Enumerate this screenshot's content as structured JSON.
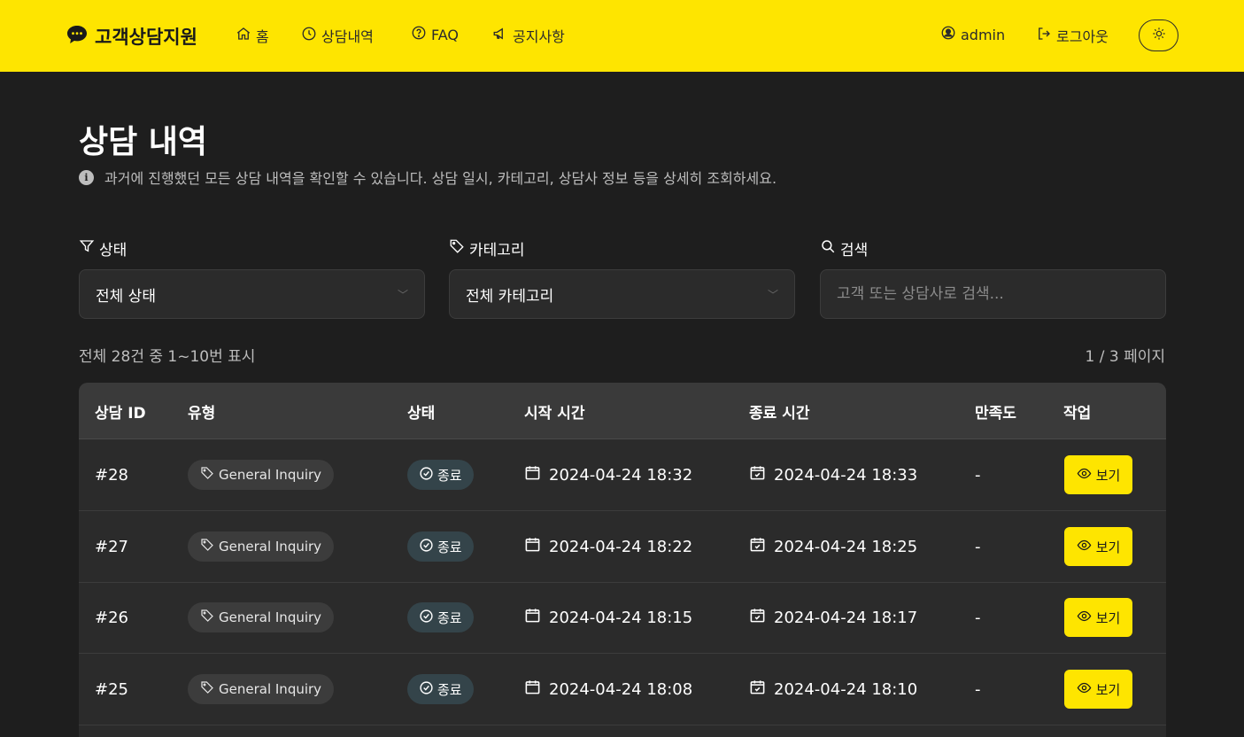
{
  "header": {
    "brand": "고객상담지원",
    "nav": [
      {
        "label": "홈",
        "icon": "home-icon"
      },
      {
        "label": "상담내역",
        "icon": "clock-icon"
      },
      {
        "label": "FAQ",
        "icon": "question-circle-icon"
      },
      {
        "label": "공지사항",
        "icon": "megaphone-icon"
      }
    ],
    "user": "admin",
    "logout": "로그아웃",
    "theme_icon": "sun-icon"
  },
  "page": {
    "title": "상담 내역",
    "subtitle": "과거에 진행했던 모든 상담 내역을 확인할 수 있습니다. 상담 일시, 카테고리, 상담사 정보 등을 상세히 조회하세요."
  },
  "filters": {
    "status_label": "상태",
    "status_value": "전체 상태",
    "category_label": "카테고리",
    "category_value": "전체 카테고리",
    "search_label": "검색",
    "search_placeholder": "고객 또는 상담사로 검색..."
  },
  "summary": {
    "count_text": "전체 28건 중 1~10번 표시",
    "page_text": "1 / 3 페이지"
  },
  "table": {
    "headers": [
      "상담 ID",
      "유형",
      "상태",
      "시작 시간",
      "종료 시간",
      "만족도",
      "작업"
    ],
    "rows": [
      {
        "id": "#28",
        "type": "General Inquiry",
        "status": "종료",
        "start": "2024-04-24 18:32",
        "end": "2024-04-24 18:33",
        "satisfaction": "-",
        "action": "보기"
      },
      {
        "id": "#27",
        "type": "General Inquiry",
        "status": "종료",
        "start": "2024-04-24 18:22",
        "end": "2024-04-24 18:25",
        "satisfaction": "-",
        "action": "보기"
      },
      {
        "id": "#26",
        "type": "General Inquiry",
        "status": "종료",
        "start": "2024-04-24 18:15",
        "end": "2024-04-24 18:17",
        "satisfaction": "-",
        "action": "보기"
      },
      {
        "id": "#25",
        "type": "General Inquiry",
        "status": "종료",
        "start": "2024-04-24 18:08",
        "end": "2024-04-24 18:10",
        "satisfaction": "-",
        "action": "보기"
      }
    ]
  },
  "colors": {
    "accent": "#fee500",
    "background": "#1e1e1e",
    "surface": "#2b2b2b",
    "status_bg": "#34444a"
  }
}
